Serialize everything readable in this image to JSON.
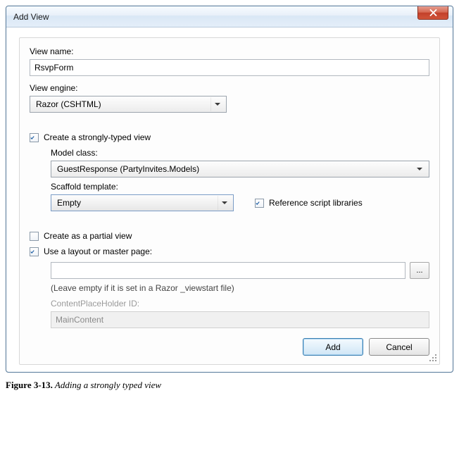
{
  "window": {
    "title": "Add View"
  },
  "viewName": {
    "label": "View name:",
    "value": "RsvpForm"
  },
  "viewEngine": {
    "label": "View engine:",
    "value": "Razor (CSHTML)"
  },
  "stronglyTyped": {
    "checkboxLabel": "Create a strongly-typed view",
    "checked": true,
    "modelClass": {
      "label": "Model class:",
      "value": "GuestResponse (PartyInvites.Models)"
    },
    "scaffold": {
      "label": "Scaffold template:",
      "value": "Empty"
    },
    "referenceScripts": {
      "label": "Reference script libraries",
      "checked": true
    }
  },
  "partialView": {
    "label": "Create as a partial view",
    "checked": false
  },
  "layout": {
    "checkboxLabel": "Use a layout or master page:",
    "checked": true,
    "path": "",
    "hint": "(Leave empty if it is set in a Razor _viewstart file)",
    "placeholderId": {
      "label": "ContentPlaceHolder ID:",
      "value": "MainContent"
    }
  },
  "buttons": {
    "add": "Add",
    "cancel": "Cancel",
    "browse": "..."
  },
  "caption": {
    "figure": "Figure 3-13.",
    "text": " Adding a strongly typed view"
  }
}
